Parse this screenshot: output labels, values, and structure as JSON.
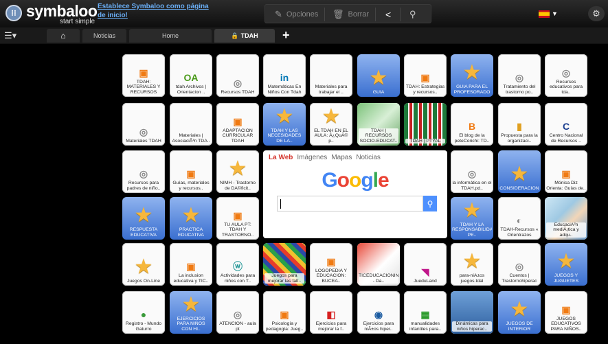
{
  "header": {
    "logo_text": "symbaloo",
    "logo_sub": "start simple",
    "homepage_link": "Establece Symbaloo como página de inicio!",
    "options_label": "Opciones",
    "delete_label": "Borrar"
  },
  "tabs": [
    {
      "label": "Noticias"
    },
    {
      "label": "Home"
    },
    {
      "label": "TDAH"
    }
  ],
  "tiles": [
    {
      "label": "TDAH: MATERIALES Y RECURSOS",
      "icon": "▣",
      "color": "#f07a12"
    },
    {
      "label": "tdah Archivos | Orientacion ..",
      "icon": "OA",
      "color": "#4a9a1a"
    },
    {
      "label": "Recursos TDAH",
      "icon": "◎",
      "color": "#888"
    },
    {
      "label": "Matemáticas En Niños Con Tdah",
      "icon": "in",
      "color": "#0077b5"
    },
    {
      "label": "Materiales para trabajar el ..",
      "icon": "",
      "color": "#888"
    },
    {
      "label": "GUIA",
      "star": true
    },
    {
      "label": "TDAH: Estrategias y recursos..",
      "icon": "▣",
      "color": "#f07a12"
    },
    {
      "label": "GUIA PARA EL PROFESORADO",
      "star": true
    },
    {
      "label": "Tratamiento del trastorno po..",
      "icon": "◎",
      "color": "#888"
    },
    {
      "label": "Recursos educativos para tda..",
      "icon": "◎",
      "color": "#888"
    },
    {
      "label": "Materiales TDAH",
      "icon": "◎",
      "color": "#888"
    },
    {
      "label": "Materiales | AsociaciÃ³n TDA..",
      "icon": "",
      "color": "#888"
    },
    {
      "label": "ADAPTACION CURRICULAR TDAH",
      "icon": "▣",
      "color": "#f07a12"
    },
    {
      "label": "TDAH Y LAS NECESIDADES DE LA..",
      "star": true
    },
    {
      "label": "EL TDAH EN EL AULA: Â¿QuÃ© p..",
      "star": true,
      "white": true
    },
    {
      "label": "TDAH | RECURSOS SOCIO-EDUCAT..",
      "photo": "green"
    },
    {
      "label": "TDAH | PTYAL",
      "photo": "table"
    },
    {
      "label": "El blog de la peteCorichi: TD..",
      "icon": "B",
      "color": "#f07a12"
    },
    {
      "label": "Propuesta para la organizaci..",
      "icon": "▮",
      "color": "#e0a020"
    },
    {
      "label": "Centro Nacional de Recursos ..",
      "icon": "C",
      "color": "#1a3d8f"
    },
    {
      "label": "Recursos para padres de niño..",
      "icon": "◎",
      "color": "#888"
    },
    {
      "label": "Guías, materiales y recursos..",
      "icon": "▣",
      "color": "#f07a12"
    },
    {
      "label": "NIMH - Trastorno de DA©ficit..",
      "star": true,
      "white": true
    },
    {
      "label": "la informática en el TDAH.pd..",
      "icon": "◎",
      "color": "#888"
    },
    {
      "label": "CONSIDERACION",
      "star": true
    },
    {
      "label": "Mónica Diz Orienta: Guías de..",
      "icon": "▣",
      "color": "#f07a12"
    },
    {
      "label": "RESPUESTA EDUCATIVA",
      "star": true
    },
    {
      "label": "PRACTICA EDUCATIVA",
      "star": true
    },
    {
      "label": "TU AULA PT: TDAH Y TRASTORNO..",
      "icon": "▣",
      "color": "#f07a12"
    },
    {
      "label": "TDAH Y LA RESPONSABILIDA PE..",
      "star": true
    },
    {
      "label": "TDAH-Recursos « Orientrazos",
      "icon": "◐",
      "color": "#888"
    },
    {
      "label": "EducaciÃ³n mediÃ¡tica y adqu..",
      "photo": "kid"
    },
    {
      "label": "Juegos On-Line",
      "star": true,
      "white": true
    },
    {
      "label": "La inclusion educativa y TIC..",
      "icon": "▣",
      "color": "#f07a12"
    },
    {
      "label": "Actividades para niños con T..",
      "icon": "ⓦ",
      "color": "#2a9a9a"
    },
    {
      "label": "Juegos para mejorar las falt..",
      "photo": "games"
    },
    {
      "label": "LOGOPEDIA Y EDUCACION: BUCEA..",
      "icon": "▣",
      "color": "#f07a12"
    },
    {
      "label": "TICEDUCACIONIN - Da..",
      "photo": "red"
    },
    {
      "label": "JueduLand",
      "icon": "◥",
      "color": "#c0168a"
    },
    {
      "label": "para-niÃ±os juegos.tdal",
      "star": true,
      "white": true
    },
    {
      "label": "Cuentos | Trastornohiperac",
      "icon": "◎",
      "color": "#888"
    },
    {
      "label": "JUEGOS Y JUGUETES",
      "star": true
    },
    {
      "label": "Registro - Mundo Gaturro",
      "icon": "●",
      "color": "#3a9a3a"
    },
    {
      "label": "EJERCICIOS PARA NIÑOS CON HI..",
      "star": true
    },
    {
      "label": "ATENCIÓN - aula pt",
      "icon": "◎",
      "color": "#888"
    },
    {
      "label": "Psicología y pedagogía: Jueg..",
      "icon": "▣",
      "color": "#f07a12"
    },
    {
      "label": "Ejercicios para mejorar la f..",
      "icon": "◧",
      "color": "#d62020"
    },
    {
      "label": "Ejercicios para niÃ±os hiper..",
      "icon": "◉",
      "color": "#1a5aa0"
    },
    {
      "label": "manualidades infantiles para..",
      "icon": "▦",
      "color": "#2a9a2a"
    },
    {
      "label": "Dinámicas para niños hiperac..",
      "photo": "blue"
    },
    {
      "label": "JUEGOS DE INTERIOR",
      "star": true
    },
    {
      "label": "JUEGOS EDUCATIVOS PARA NIÑOS..",
      "icon": "▣",
      "color": "#f07a12"
    }
  ],
  "google_widget": {
    "tabs": [
      "La Web",
      "Imágenes",
      "Mapas",
      "Noticias"
    ],
    "logo_letters": [
      {
        "ch": "G",
        "color": "#4285f4"
      },
      {
        "ch": "o",
        "color": "#ea4335"
      },
      {
        "ch": "o",
        "color": "#fbbc05"
      },
      {
        "ch": "g",
        "color": "#4285f4"
      },
      {
        "ch": "l",
        "color": "#34a853"
      },
      {
        "ch": "e",
        "color": "#ea4335"
      }
    ]
  }
}
